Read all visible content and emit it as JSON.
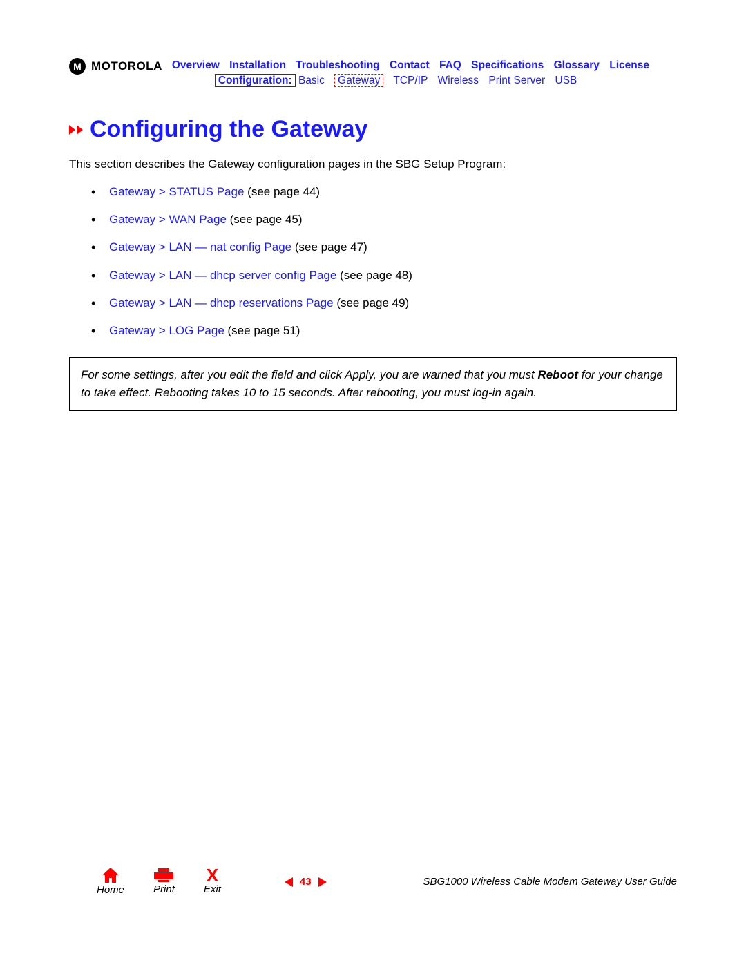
{
  "brand": "MOTOROLA",
  "nav_top": [
    "Overview",
    "Installation",
    "Troubleshooting",
    "Contact",
    "FAQ",
    "Specifications",
    "Glossary",
    "License"
  ],
  "nav_sub": {
    "boxed": "Configuration:",
    "items": [
      "Basic",
      "Gateway",
      "TCP/IP",
      "Wireless",
      "Print Server",
      "USB"
    ],
    "dashed_index": 1
  },
  "title": "Configuring the Gateway",
  "intro": "This section describes the Gateway configuration pages in the SBG Setup Program:",
  "links": [
    {
      "text": "Gateway > STATUS Page",
      "tail": " (see page 44)"
    },
    {
      "text": "Gateway > WAN Page",
      "tail": " (see page 45)"
    },
    {
      "text": "Gateway > LAN — nat config Page",
      "tail": " (see page 47)"
    },
    {
      "text": "Gateway > LAN — dhcp server config Page",
      "tail": " (see page 48)"
    },
    {
      "text": "Gateway > LAN — dhcp reservations Page",
      "tail": " (see page 49)"
    },
    {
      "text": "Gateway > LOG Page",
      "tail": " (see page 51)"
    }
  ],
  "note_pre": "For some settings, after you edit the field and click Apply, you are warned that you must ",
  "note_bold": "Reboot",
  "note_post": " for your change to take effect. Rebooting takes 10 to 15 seconds. After rebooting, you must log-in again.",
  "footer": {
    "home": "Home",
    "print": "Print",
    "exit": "Exit",
    "page": "43",
    "doc": "SBG1000 Wireless Cable Modem Gateway User Guide"
  }
}
